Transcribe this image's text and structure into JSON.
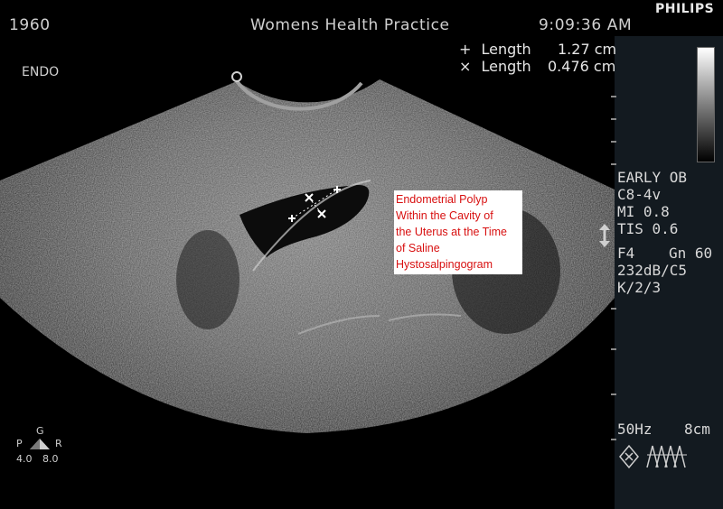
{
  "header": {
    "patient_id": "1960",
    "practice": "Womens Health Practice",
    "time": "9:09:36 AM",
    "brand": "PHILIPS"
  },
  "mode_label": "ENDO",
  "measurements": [
    {
      "symbol": "+",
      "label": "Length",
      "value": "1.27 cm"
    },
    {
      "symbol": "×",
      "label": "Length",
      "value": "0.476 cm"
    }
  ],
  "annotation": {
    "lines": [
      "Endometrial Polyp",
      "Within the Cavity of",
      "the Uterus at the Time",
      "of Saline",
      "Hystosalpingogram"
    ]
  },
  "side_panel": {
    "preset": "EARLY OB",
    "probe": "C8-4v",
    "mi": "MI 0.8",
    "tis": "TIS 0.6",
    "freq": "F4",
    "gain": "Gn 60",
    "dyn": "232dB/C5",
    "k": "K/2/3",
    "frame_rate": "50Hz",
    "depth": "8cm"
  },
  "orientation": {
    "g": "G",
    "p": "P",
    "r": "R",
    "p_val": "4.0",
    "r_val": "8.0"
  },
  "colors": {
    "annotation_text": "#d81010",
    "panel_bg": "#131a20"
  }
}
